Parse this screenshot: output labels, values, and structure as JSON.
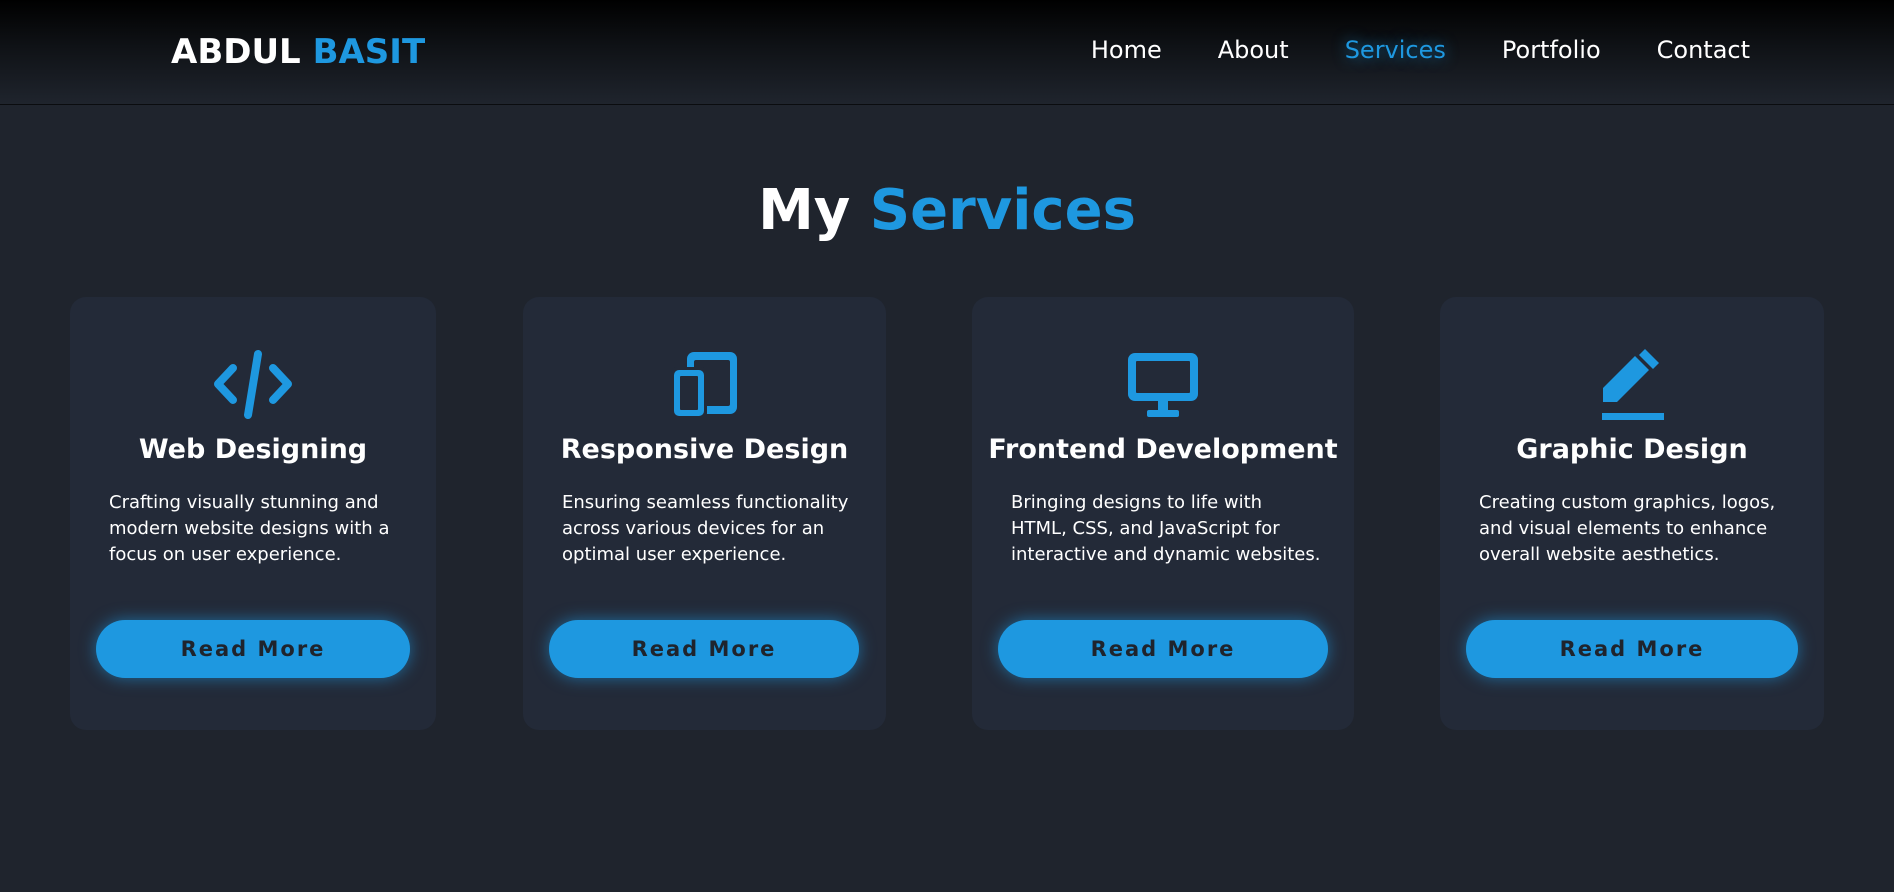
{
  "header": {
    "logo_first": "ABDUL",
    "logo_second": "BASIT",
    "nav": [
      {
        "label": "Home",
        "active": false
      },
      {
        "label": "About",
        "active": false
      },
      {
        "label": "Services",
        "active": true
      },
      {
        "label": "Portfolio",
        "active": false
      },
      {
        "label": "Contact",
        "active": false
      }
    ]
  },
  "section": {
    "title_first": "My",
    "title_accent": "Services"
  },
  "services": [
    {
      "icon": "code-icon",
      "title": "Web Designing",
      "description": "Crafting visually stunning and modern website designs with a focus on user experience.",
      "button": "Read More"
    },
    {
      "icon": "responsive-devices-icon",
      "title": "Responsive Design",
      "description": "Ensuring seamless functionality across various devices for an optimal user experience.",
      "button": "Read More"
    },
    {
      "icon": "desktop-monitor-icon",
      "title": "Frontend Development",
      "description": "Bringing designs to life with HTML, CSS, and JavaScript for interactive and dynamic websites.",
      "button": "Read More"
    },
    {
      "icon": "pen-icon",
      "title": "Graphic Design",
      "description": "Creating custom graphics, logos, and visual elements to enhance overall website aesthetics.",
      "button": "Read More"
    }
  ],
  "colors": {
    "accent": "#1e98e0",
    "background": "#1f242d",
    "card": "#232a38",
    "text": "#ffffff"
  }
}
